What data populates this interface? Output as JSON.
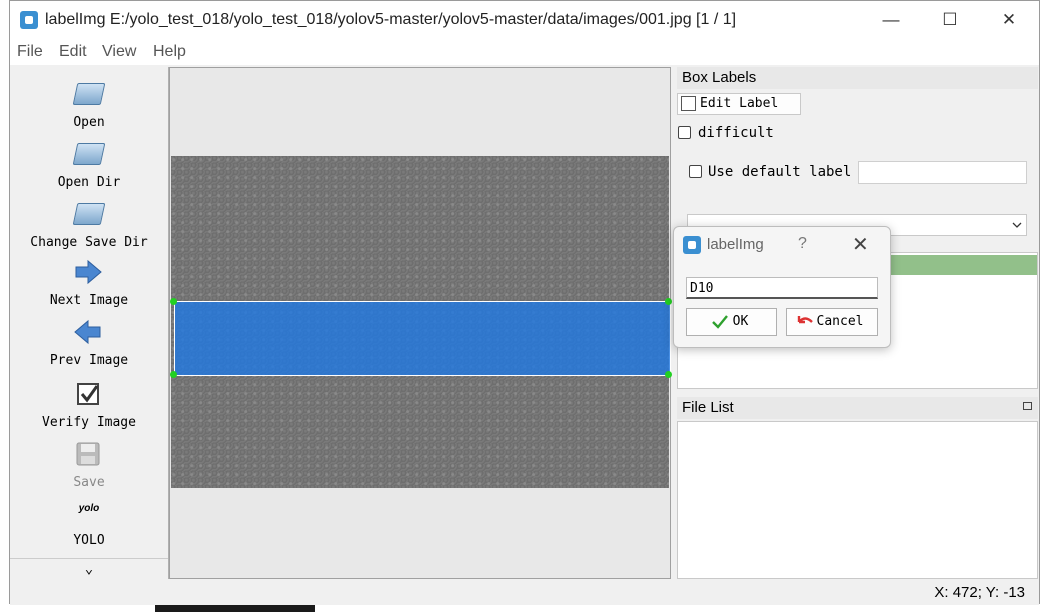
{
  "window": {
    "title": "labelImg E:/yolo_test_018/yolo_test_018/yolov5-master/yolov5-master/data/images/001.jpg [1 / 1]",
    "minimize_glyph": "—",
    "maximize_glyph": "☐",
    "close_glyph": "✕"
  },
  "menu": [
    "File",
    "Edit",
    "View",
    "Help"
  ],
  "toolbar": [
    {
      "label": "Open",
      "icon": "open-folder-icon"
    },
    {
      "label": "Open Dir",
      "icon": "open-dir-icon"
    },
    {
      "label": "Change Save Dir",
      "icon": "change-save-dir-icon"
    },
    {
      "label": "Next Image",
      "icon": "next-arrow-icon"
    },
    {
      "label": "Prev Image",
      "icon": "prev-arrow-icon"
    },
    {
      "label": "Verify Image",
      "icon": "verify-check-icon"
    },
    {
      "label": "Save",
      "icon": "save-disk-icon",
      "disabled": true
    },
    {
      "label": "YOLO",
      "icon_text": "yolo"
    },
    {
      "more_glyph": "⌄"
    }
  ],
  "box_labels": {
    "header": "Box Labels",
    "edit_label_button": "Edit Label",
    "difficult_label": "difficult",
    "difficult_checked": false,
    "use_default_label": "Use default label",
    "use_default_checked": false,
    "default_label_value": ""
  },
  "file_list": {
    "header": "File List"
  },
  "status": {
    "coords": "X: 472; Y: -13"
  },
  "dialog": {
    "title": "labelImg",
    "help_glyph": "?",
    "close_glyph": "✕",
    "input_value": "D10",
    "ok_label": "OK",
    "cancel_label": "Cancel"
  },
  "colors": {
    "bbox_fill": "#1e78e6",
    "handle": "#22d022",
    "selected_label_row": "#92c08a"
  }
}
